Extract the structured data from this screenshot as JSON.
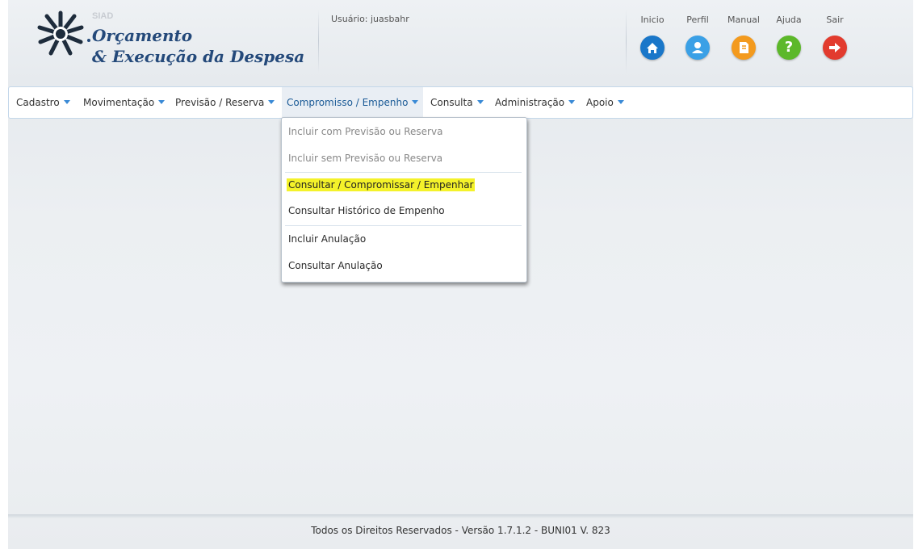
{
  "header": {
    "system_label": "SIAD",
    "title_line1": "Orçamento",
    "title_line2": "& Execução da Despesa",
    "user_label": "Usuário: juasbahr",
    "nav_icons": [
      {
        "label": "Inicio",
        "icon": "home-icon",
        "color": "#1a77c9"
      },
      {
        "label": "Perfil",
        "icon": "user-icon",
        "color": "#3aa0e6"
      },
      {
        "label": "Manual",
        "icon": "document-icon",
        "color": "#f39a1e"
      },
      {
        "label": "Ajuda",
        "icon": "help-icon",
        "color": "#5cb82a"
      },
      {
        "label": "Sair",
        "icon": "exit-icon",
        "color": "#e23b2e"
      }
    ]
  },
  "menu": {
    "items": [
      {
        "label": "Cadastro"
      },
      {
        "label": "Movimentação"
      },
      {
        "label": "Previsão / Reserva"
      },
      {
        "label": "Compromisso / Empenho"
      },
      {
        "label": "Consulta"
      },
      {
        "label": "Administração"
      },
      {
        "label": "Apoio"
      }
    ],
    "active_index": 3
  },
  "dropdown": {
    "items": [
      {
        "label": "Incluir com Previsão ou Reserva",
        "state": "disabled"
      },
      {
        "label": "Incluir sem Previsão ou Reserva",
        "state": "disabled"
      },
      {
        "label": "Consultar / Compromissar / Empenhar",
        "state": "highlighted"
      },
      {
        "label": "Consultar Histórico de Empenho",
        "state": "enabled"
      },
      {
        "label": "Incluir Anulação",
        "state": "enabled"
      },
      {
        "label": "Consultar Anulação",
        "state": "enabled"
      }
    ]
  },
  "footer": {
    "text": "Todos os Direitos Reservados - Versão 1.7.1.2 - BUNI01 V. 823"
  },
  "colors": {
    "accent": "#3a8ad6",
    "title": "#24497a",
    "highlight": "#f4f22a"
  }
}
